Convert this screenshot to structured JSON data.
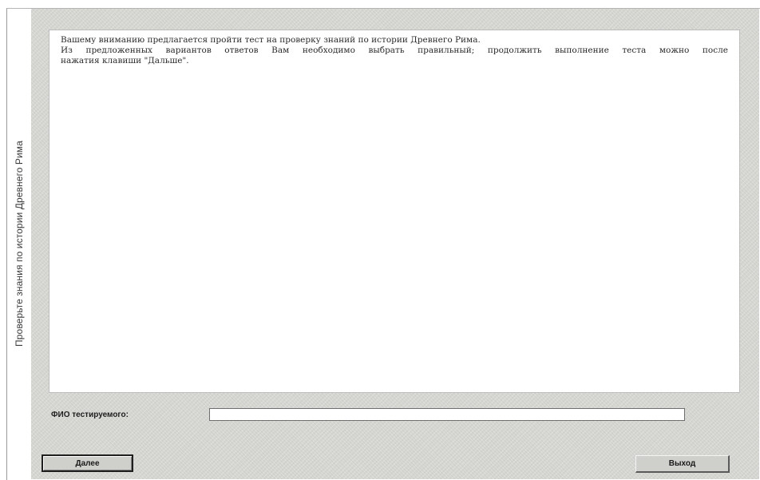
{
  "sidebar": {
    "title": "Проверьте знания по истории Древнего Рима"
  },
  "content": {
    "line1": "Вашему вниманию предлагается пройти тест на проверку знаний по истории Древнего Рима.",
    "line2": "Из предложенных вариантов ответов Вам необходимо выбрать правильный; продолжить выполнение теста можно после",
    "line3": "нажатия клавиши \"Дальше\"."
  },
  "form": {
    "fio_label": "ФИО тестируемого:",
    "fio_value": ""
  },
  "buttons": {
    "next_label": "Далее",
    "exit_label": "Выход"
  }
}
